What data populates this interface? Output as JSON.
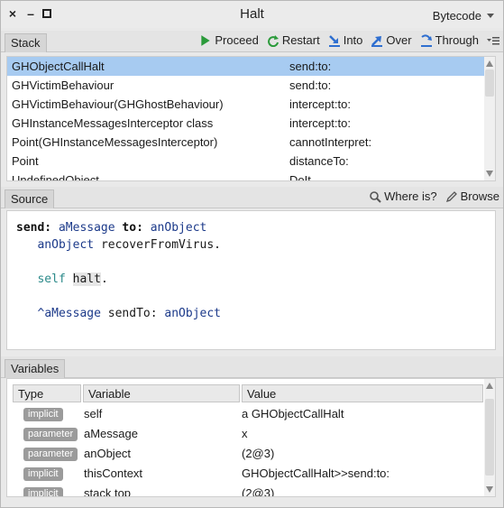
{
  "window": {
    "title": "Halt",
    "close_glyph": "×",
    "minimize_glyph": "–",
    "bytecode_label": "Bytecode"
  },
  "stack_pane": {
    "tab": "Stack",
    "toolbar": {
      "proceed": "Proceed",
      "restart": "Restart",
      "into": "Into",
      "over": "Over",
      "through": "Through"
    },
    "frames": [
      {
        "receiver": "GHObjectCallHalt",
        "selector": "send:to:"
      },
      {
        "receiver": "GHVictimBehaviour",
        "selector": "send:to:"
      },
      {
        "receiver": "GHVictimBehaviour(GHGhostBehaviour)",
        "selector": "intercept:to:"
      },
      {
        "receiver": "GHInstanceMessagesInterceptor class",
        "selector": "intercept:to:"
      },
      {
        "receiver": "Point(GHInstanceMessagesInterceptor)",
        "selector": "cannotInterpret:"
      },
      {
        "receiver": "Point",
        "selector": "distanceTo:"
      },
      {
        "receiver": "UndefinedObject",
        "selector": "DoIt"
      }
    ]
  },
  "source_pane": {
    "tab": "Source",
    "where_is": "Where is?",
    "browse": "Browse",
    "code": {
      "l1_kw1": "send:",
      "l1_arg1": "aMessage",
      "l1_kw2": "to:",
      "l1_arg2": "anObject",
      "l2_arg": "anObject",
      "l2_msg": "recoverFromVirus.",
      "l3_self": "self",
      "l3_msg": "halt",
      "l3_dot": ".",
      "l4_caret": "^",
      "l4_arg": "aMessage",
      "l4_msg": "sendTo:",
      "l4_arg2": "anObject"
    }
  },
  "variables_pane": {
    "tab": "Variables",
    "columns": [
      "Type",
      "Variable",
      "Value"
    ],
    "rows": [
      {
        "type": "implicit",
        "name": "self",
        "value": "a GHObjectCallHalt"
      },
      {
        "type": "parameter",
        "name": "aMessage",
        "value": "x"
      },
      {
        "type": "parameter",
        "name": "anObject",
        "value": "(2@3)"
      },
      {
        "type": "implicit",
        "name": "thisContext",
        "value": "GHObjectCallHalt>>send:to:"
      },
      {
        "type": "implicit",
        "name": "stack top",
        "value": "(2@3)"
      }
    ]
  },
  "colors": {
    "selection": "#a7cbf1",
    "badge": "#9b9b9b",
    "accent_blue": "#2f6fd0",
    "proceed_green": "#2a9a3a"
  },
  "icons": {
    "proceed": "play-icon",
    "restart": "restart-icon",
    "into": "step-into-icon",
    "over": "step-over-icon",
    "through": "step-through-icon",
    "where_is": "magnifier-icon",
    "browse": "pencil-icon"
  }
}
